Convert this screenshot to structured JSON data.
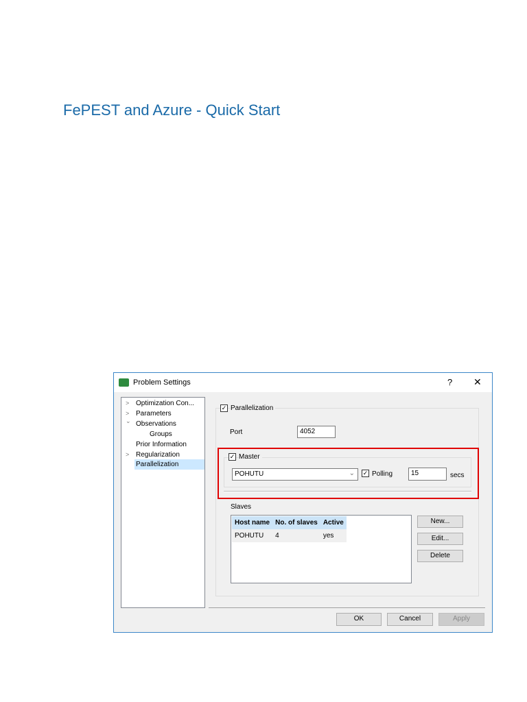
{
  "doc_title": "FePEST and Azure - Quick Start",
  "dialog": {
    "title": "Problem Settings",
    "help": "?",
    "close": "✕",
    "tree": [
      {
        "label": "Optimization Con...",
        "chevron": ">"
      },
      {
        "label": "Parameters",
        "chevron": ">"
      },
      {
        "label": "Observations",
        "chevron": "⌄"
      },
      {
        "label": "Groups",
        "chevron": ""
      },
      {
        "label": "Prior Information",
        "chevron": ""
      },
      {
        "label": "Regularization",
        "chevron": ">"
      },
      {
        "label": "Parallelization",
        "chevron": "",
        "selected": true
      }
    ],
    "parallelization_label": "Parallelization",
    "parallelization_checked": true,
    "port_label": "Port",
    "port_value": "4052",
    "master_label": "Master",
    "master_checked": true,
    "master_host": "POHUTU",
    "polling_label": "Polling",
    "polling_checked": true,
    "polling_value": "15",
    "secs_label": "secs",
    "slaves_label": "Slaves",
    "slaves_columns": [
      "Host name",
      "No. of slaves",
      "Active"
    ],
    "slaves_rows": [
      [
        "POHUTU",
        "4",
        "yes"
      ]
    ],
    "new_button": "New...",
    "edit_button": "Edit...",
    "delete_button": "Delete",
    "ok_button": "OK",
    "cancel_button": "Cancel",
    "apply_button": "Apply",
    "highlight_color": "#e00000"
  }
}
